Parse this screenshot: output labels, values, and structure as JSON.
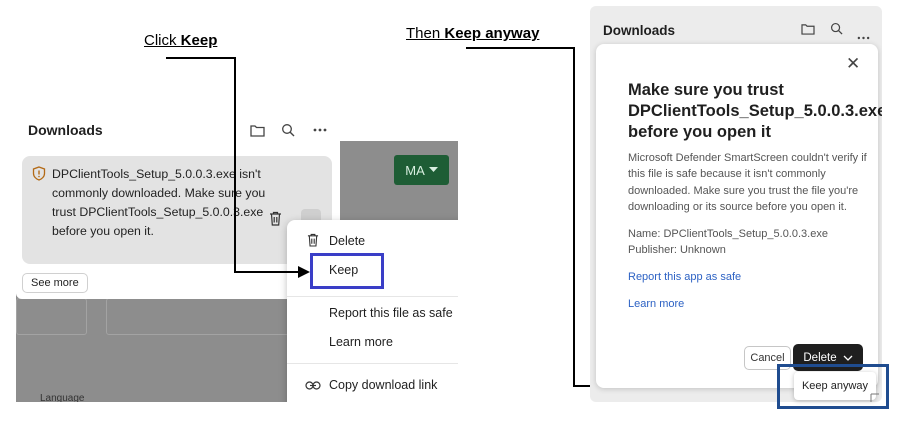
{
  "labels": {
    "step1_prefix": "Click ",
    "step1_bold": "Keep",
    "step2_prefix": "Then ",
    "step2_bold": "Keep anyway"
  },
  "left": {
    "panel_title": "Downloads",
    "warning_text": "DPClientTools_Setup_5.0.0.3.exe isn't commonly downloaded. Make sure you trust DPClientTools_Setup_5.0.0.3.exe before you open it.",
    "see_more": "See more",
    "ma_button": "MA",
    "language_label": "Language",
    "menu": {
      "delete": "Delete",
      "keep": "Keep",
      "report": "Report this file as safe",
      "learn_more": "Learn more",
      "copy_link": "Copy download link"
    },
    "icons": [
      "folder-icon",
      "search-icon",
      "more-icon",
      "warning-icon",
      "trash-icon",
      "link-icon"
    ]
  },
  "right": {
    "panel_title": "Downloads",
    "dialog_heading": "Make sure you trust DPClientTools_Setup_5.0.0.3.exe before you open it",
    "dialog_body": "Microsoft Defender SmartScreen couldn't verify if this file is safe because it isn't commonly downloaded. Make sure you trust the file you're downloading or its source before you open it.",
    "name_line": "Name: DPClientTools_Setup_5.0.0.3.exe",
    "publisher_line": "Publisher: Unknown",
    "report_link": "Report this app as safe",
    "learn_more_link": "Learn more",
    "cancel_button": "Cancel",
    "delete_button": "Delete",
    "keep_anyway": "Keep anyway"
  },
  "colors": {
    "keep_highlight": "#3a3ec7",
    "keep_anyway_highlight": "#1f4c8f",
    "link": "#2d62c4",
    "ma_button": "#1e5d35"
  }
}
